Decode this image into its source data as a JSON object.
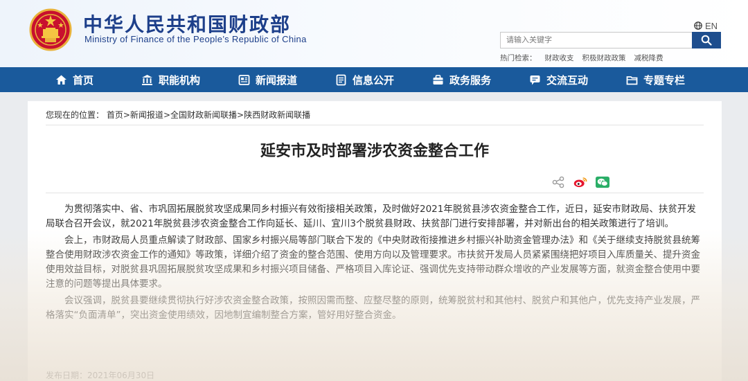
{
  "header": {
    "title_cn": "中华人民共和国财政部",
    "title_en": "Ministry of Finance of the People’s Republic of China",
    "lang_label": "EN",
    "search_placeholder": "请输入关键字",
    "hot_label": "热门检索：",
    "hot_words": [
      "财政收支",
      "积极财政政策",
      "减税降费"
    ]
  },
  "nav": {
    "items": [
      {
        "label": "首页",
        "icon": "home-icon"
      },
      {
        "label": "职能机构",
        "icon": "building-icon"
      },
      {
        "label": "新闻报道",
        "icon": "newspaper-icon"
      },
      {
        "label": "信息公开",
        "icon": "document-icon"
      },
      {
        "label": "政务服务",
        "icon": "service-icon"
      },
      {
        "label": "交流互动",
        "icon": "chat-icon"
      },
      {
        "label": "专题专栏",
        "icon": "folder-icon"
      }
    ]
  },
  "breadcrumb": {
    "prefix": "您现在的位置：",
    "items": [
      "首页",
      "新闻报道",
      "全国财政新闻联播",
      "陕西财政新闻联播"
    ],
    "separator": ">"
  },
  "article": {
    "title": "延安市及时部署涉农资金整合工作",
    "paragraphs": [
      "为贯彻落实中、省、市巩固拓展脱贫攻坚成果同乡村振兴有效衔接相关政策，及时做好2021年脱贫县涉农资金整合工作，近日，延安市财政局、扶贫开发局联合召开会议，就2021年脱贫县涉农资金整合工作向延长、延川、宜川3个脱贫县财政、扶贫部门进行安排部署，并对新出台的相关政策进行了培训。",
      "会上，市财政局人员重点解读了财政部、国家乡村振兴局等部门联合下发的《中央财政衔接推进乡村振兴补助资金管理办法》和《关于继续支持脱贫县统筹整合使用财政涉农资金工作的通知》等政策，详细介绍了资金的整合范围、使用方向以及管理要求。市扶贫开发局人员紧紧围绕把好项目入库质量关、提升资金使用效益目标，对脱贫县巩固拓展脱贫攻坚成果和乡村振兴项目储备、严格项目入库论证、强调优先支持带动群众增收的产业发展等方面，就资金整合使用中要注意的问题等提出具体要求。",
      "会议强调，脱贫县要继续贯彻执行好涉农资金整合政策，按照因需而整、应整尽整的原则，统筹脱贫村和其他村、脱贫户和其他户，优先支持产业发展，严格落实“负面清单”，突出资金使用绩效，因地制宜编制整合方案，管好用好整合资金。"
    ],
    "pubdate": "发布日期：2021年06月30日"
  },
  "colors": {
    "nav_bg": "#1a5a9c",
    "title_blue": "#1d3f8a",
    "search_btn": "#1e4e8e",
    "weibo_red": "#e6162d",
    "wechat_green": "#2aae67"
  }
}
